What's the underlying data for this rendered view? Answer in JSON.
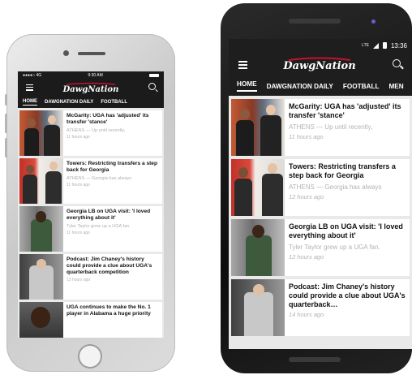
{
  "brand": {
    "logo_text": "DawgNation"
  },
  "iphone": {
    "status": {
      "carrier": "●●●●○ 4G",
      "time": "9:30 AM"
    },
    "tabs": [
      "HOME",
      "DAWGNATION DAILY",
      "FOOTBALL"
    ],
    "active_tab": "HOME",
    "articles": [
      {
        "headline": "McGarity: UGA has 'adjusted' its transfer 'stance'",
        "excerpt": "ATHENS — Up until recently,",
        "time": "11 hours ago"
      },
      {
        "headline": "Towers: Restricting transfers a step back for Georgia",
        "excerpt": "ATHENS — Georgia has always",
        "time": "11 hours ago"
      },
      {
        "headline": "Georgia LB on UGA visit: 'I loved everything about it'",
        "excerpt": "Tyler Taylor grew up a UGA fan.",
        "time": "11 hours ago"
      },
      {
        "headline": "Podcast: Jim Chaney's history could provide a clue about UGA's quarterback competition",
        "excerpt": "",
        "time": "13 hours ago"
      },
      {
        "headline": "UGA continues to make the No. 1 player in Alabama a huge priority",
        "excerpt": "",
        "time": ""
      }
    ]
  },
  "android": {
    "status": {
      "signal": "LTE",
      "time": "13:36"
    },
    "tabs": [
      "HOME",
      "DAWGNATION DAILY",
      "FOOTBALL",
      "MEN"
    ],
    "active_tab": "HOME",
    "articles": [
      {
        "headline": "McGarity: UGA has 'adjusted' its transfer 'stance'",
        "excerpt": "ATHENS — Up until recently,",
        "time": "11 hours ago"
      },
      {
        "headline": "Towers: Restricting transfers a step back for Georgia",
        "excerpt": "ATHENS — Georgia has always",
        "time": "12 hours ago"
      },
      {
        "headline": "Georgia LB on UGA visit: 'I loved everything about it'",
        "excerpt": "Tyler Taylor grew up a UGA fan.",
        "time": "12 hours ago"
      },
      {
        "headline": "Podcast: Jim Chaney's history could provide a clue about UGA's quarterback…",
        "excerpt": "",
        "time": "14 hours ago"
      }
    ]
  },
  "colors": {
    "app_bg": "#1e1e1e",
    "list_bg": "#e9e9e9",
    "brand_red": "#c8102e"
  }
}
